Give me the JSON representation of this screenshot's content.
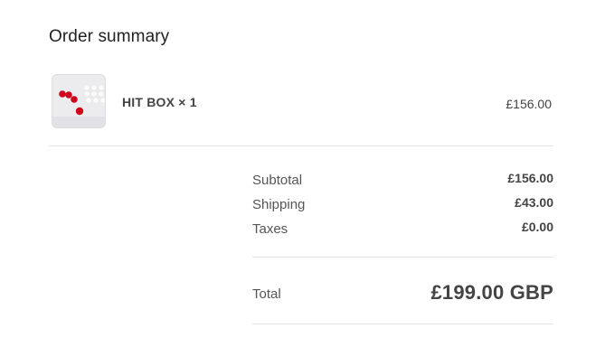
{
  "summary": {
    "title": "Order summary",
    "item": {
      "name": "HIT BOX × 1",
      "price": "£156.00",
      "image_icon": "hit-box-controller-image"
    },
    "subtotal": {
      "label": "Subtotal",
      "value": "£156.00"
    },
    "shipping": {
      "label": "Shipping",
      "value": "£43.00"
    },
    "taxes": {
      "label": "Taxes",
      "value": "£0.00"
    },
    "total": {
      "label": "Total",
      "value": "£199.00 GBP"
    }
  },
  "colors": {
    "button_red": "#d0021b",
    "button_white": "#ffffff",
    "divider": "#e2e2e2"
  }
}
